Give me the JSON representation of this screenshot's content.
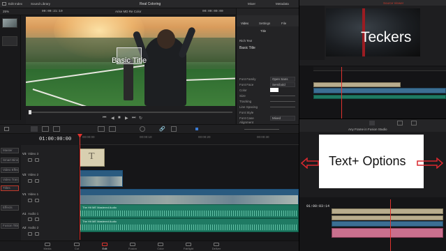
{
  "app": {
    "page_name": "Real Coloring",
    "timeline_name": "Arise MD Re Color",
    "timecode_left": "00:00:21:19",
    "timecode_right": "00:00:00:00",
    "menu_left": [
      "Edit Index",
      "Sound Library"
    ],
    "menu_right": [
      "Mixer",
      "Metadata"
    ]
  },
  "viewer": {
    "overlay_title": "Basic Title"
  },
  "inspector": {
    "header": "Timeline  Title  Text",
    "tabs": [
      "Video",
      "Settings",
      "File"
    ],
    "section_title": "Title",
    "rows": [
      {
        "label": "Rich Text",
        "value": ""
      },
      {
        "label": "Basic Title",
        "value": ""
      },
      {
        "label": "Font Family",
        "value": "Open Sans"
      },
      {
        "label": "Font Face",
        "value": "Semibold"
      },
      {
        "label": "Color",
        "value": ""
      },
      {
        "label": "Size",
        "value": ""
      },
      {
        "label": "Tracking",
        "value": ""
      },
      {
        "label": "Line Spacing",
        "value": ""
      },
      {
        "label": "Font Style",
        "value": ""
      },
      {
        "label": "Font Case",
        "value": "Mixed"
      },
      {
        "label": "Alignment",
        "value": ""
      }
    ]
  },
  "timeline": {
    "timecode": "01:00:00:00",
    "tracks": [
      {
        "id": "V3",
        "name": "Video 3"
      },
      {
        "id": "V2",
        "name": "Video 2"
      },
      {
        "id": "V1",
        "name": "Video 1"
      },
      {
        "id": "A1",
        "name": "Audio 1"
      },
      {
        "id": "A2",
        "name": "Audio 2"
      }
    ],
    "title_clip_glyph": "T",
    "audio_clip_name": "The Hit ME Mastered Audio"
  },
  "left_panel": {
    "items": [
      "Master",
      "Smart Bins",
      "Video Effects",
      "Video Transitions",
      "Generators",
      "Titles",
      "Effects",
      "Fusion Titles"
    ]
  },
  "pages": [
    {
      "label": "Media",
      "icon": "media-page-icon"
    },
    {
      "label": "Cut",
      "icon": "cut-page-icon"
    },
    {
      "label": "Edit",
      "icon": "edit-page-icon",
      "active": true
    },
    {
      "label": "Fusion",
      "icon": "fusion-page-icon"
    },
    {
      "label": "Color",
      "icon": "color-page-icon"
    },
    {
      "label": "Fairlight",
      "icon": "fairlight-page-icon"
    },
    {
      "label": "Deliver",
      "icon": "deliver-page-icon"
    }
  ],
  "right_top": {
    "viewer_text": "Teckers",
    "label": "Source Viewer"
  },
  "right_bottom": {
    "title": "Any Frame in Fusion Studio",
    "box_text": "Text+ Options",
    "timecode": "01:00:03:14"
  },
  "colors": {
    "playhead": "#e0332e",
    "audio_clip": "#1f7a63",
    "video_clip": "#3c6f93",
    "title_clip": "#d8cfb0",
    "pink_clip": "#c9708e"
  }
}
